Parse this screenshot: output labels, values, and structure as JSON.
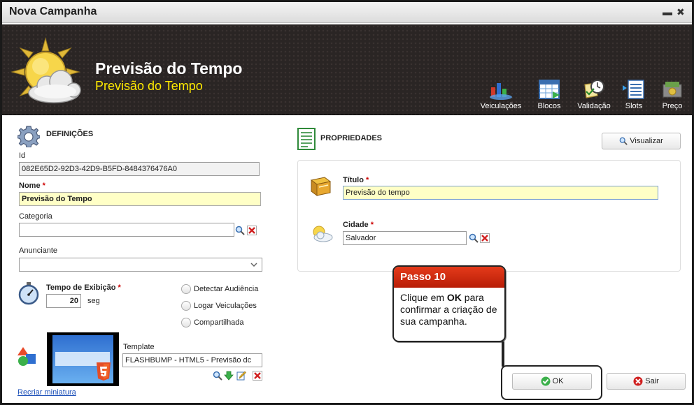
{
  "window": {
    "title": "Nova Campanha",
    "minimize_glyph": "▬",
    "close_glyph": "✖"
  },
  "header": {
    "title": "Previsão do Tempo",
    "subtitle": "Previsão do Tempo",
    "icon": "weather-sun-cloud-icon",
    "toolbar": [
      {
        "label": "Veiculações",
        "icon": "chart-icon"
      },
      {
        "label": "Blocos",
        "icon": "calendar-grid-icon"
      },
      {
        "label": "Validação",
        "icon": "clock-check-icon"
      },
      {
        "label": "Slots",
        "icon": "slots-list-icon"
      },
      {
        "label": "Preço",
        "icon": "money-icon"
      }
    ]
  },
  "definicoes": {
    "heading": "DEFINIÇÕES",
    "id_label": "Id",
    "id_value": "082E65D2-92D3-42D9-B5FD-8484376476A0",
    "nome_label": "Nome",
    "nome_value": "Previsão do Tempo",
    "categoria_label": "Categoria",
    "categoria_value": "",
    "anunciante_label": "Anunciante",
    "anunciante_value": "",
    "tempo_label": "Tempo de Exibição",
    "tempo_value": "20",
    "tempo_unit": "seg",
    "options": [
      "Detectar Audiência",
      "Logar Veiculações",
      "Compartilhada"
    ],
    "template_label": "Template",
    "template_value": "FLASHBUMP - HTML5 - Previsão dc",
    "recreate_link": "Recriar miniatura"
  },
  "propriedades": {
    "heading": "PROPRIEDADES",
    "preview_button": "Visualizar",
    "titulo_label": "Título",
    "titulo_value": "Previsão do tempo",
    "cidade_label": "Cidade",
    "cidade_value": "Salvador"
  },
  "required_mark": "*",
  "callout": {
    "heading": "Passo 10",
    "body_pre": "Clique em ",
    "body_bold": "OK",
    "body_post": " para confirmar a criação de sua campanha."
  },
  "footer": {
    "ok_label": "OK",
    "exit_label": "Sair"
  },
  "colors": {
    "header_bg": "#2a2524",
    "subtitle": "#ffea00",
    "callout_header": "#d32e0f",
    "highlight_field": "#ffffc6"
  }
}
